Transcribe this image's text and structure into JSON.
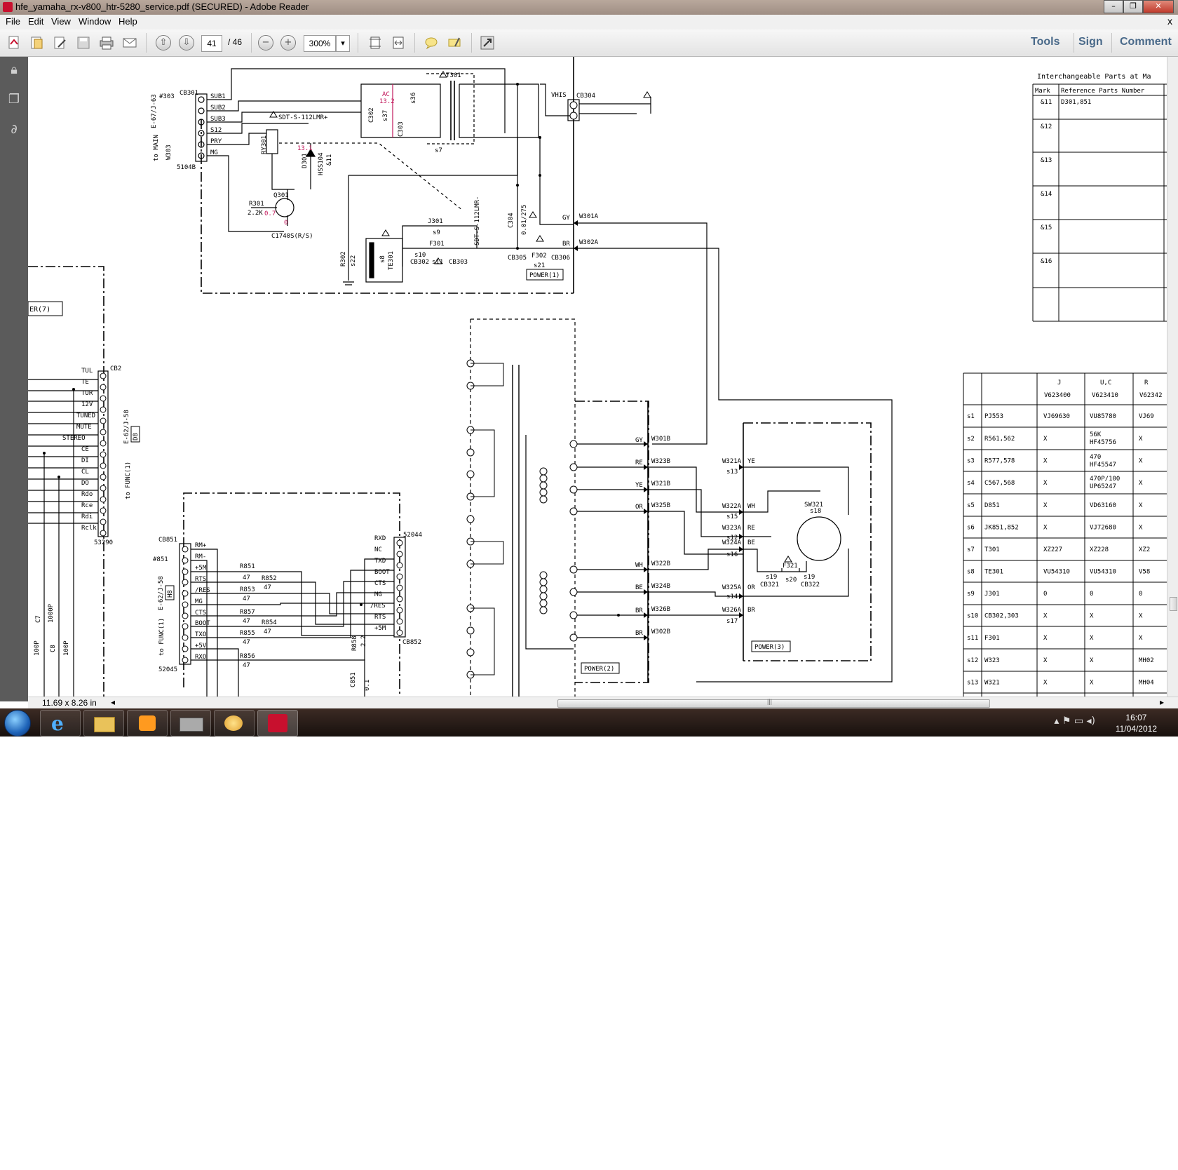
{
  "window": {
    "title": "hfe_yamaha_rx-v800_htr-5280_service.pdf (SECURED) - Adobe Reader",
    "controls": {
      "minimize": "–",
      "restore": "❐",
      "close": "✕"
    }
  },
  "menu": {
    "items": [
      "File",
      "Edit",
      "View",
      "Window",
      "Help"
    ],
    "close_doc": "x"
  },
  "toolbar": {
    "page_current": "41",
    "page_total": "/ 46",
    "zoom": "300%",
    "zoom_dropdown": "▾",
    "tools_label": "Tools",
    "sign_label": "Sign",
    "comment_label": "Comment",
    "icons": [
      "create-pdf-icon",
      "open-icon",
      "edit-icon",
      "save-icon",
      "print-icon",
      "email-icon",
      "page-up-icon",
      "page-down-icon",
      "zoom-out-icon",
      "zoom-in-icon",
      "fit-page-icon",
      "fit-width-icon",
      "comment-icon",
      "highlight-icon",
      "fullscreen-icon"
    ],
    "accent": "#4a6a8a"
  },
  "statusbar": {
    "page_size": "11.69 x 8.26 in",
    "scroll_left": "◂",
    "scroll_right": "▸",
    "thumb_grip": "|||"
  },
  "taskbar": {
    "time": "16:07",
    "date": "11/04/2012",
    "apps": [
      "internet-explorer-icon",
      "file-explorer-icon",
      "media-player-icon",
      "scanner-icon",
      "paint-icon",
      "adobe-reader-icon"
    ]
  },
  "schematic": {
    "connector_labels": [
      "SUB1",
      "SUB2",
      "SUB3",
      "S12",
      "PRY",
      "MG"
    ],
    "left_labels": [
      "#303",
      "E-67/J-63",
      "to MAIN",
      "W303",
      "CB301",
      "5104B"
    ],
    "relay": "SDT-S-112LMR+",
    "relay2": "SDT-S-112LMR-",
    "transformer": "T301",
    "parts": [
      "RY301",
      "D301",
      "HSS104",
      "&11",
      "R301",
      "2.2K",
      "Q301",
      "C1740S(R/S)",
      "C302",
      "C303",
      "s37",
      "s36",
      "s7",
      "AC",
      "13.2",
      "13.1",
      "0.7",
      "0",
      "J301",
      "s9",
      "F301",
      "s10",
      "s11",
      "CB302",
      "CB303",
      "R302",
      "s22",
      "TE301",
      "s8",
      "C304",
      "0.01/275",
      "CB305",
      "F302",
      "s21",
      "CB306",
      "VHIS",
      "CB304",
      "GY",
      "W301A",
      "BR",
      "W302A",
      "POWER(1)"
    ],
    "func_block": {
      "label": "ER(7)",
      "cb": "CB2",
      "pins": [
        "TUL",
        "TE",
        "TUR",
        "12V",
        "TUNED",
        "MUTE",
        "STEREO",
        "CE",
        "DI",
        "CL",
        "DO",
        "Rdo",
        "Rce",
        "Rdi",
        "Rclk"
      ],
      "connector": "53290",
      "side": "E-62/J-58",
      "box": "D8",
      "to": "to FUNC(1)"
    },
    "cb851": {
      "name": "CB851",
      "ref": "#851",
      "side": "E-62/J-58",
      "box": "H8",
      "to": "to FUNC(1)",
      "connector": "52045",
      "pins": [
        "RM+",
        "RM-",
        "+5M",
        "RTS",
        "/RES",
        "MG",
        "CTS",
        "BOOT",
        "TXO",
        "+5V",
        "RXO"
      ],
      "resistors": [
        "R851",
        "R852",
        "R853",
        "R857",
        "R854",
        "R855",
        "R856",
        "R858"
      ],
      "values": [
        "47",
        "47",
        "47",
        "47",
        "47",
        "47",
        "47",
        "2.2"
      ]
    },
    "cb852": {
      "name": "CB852",
      "connector": "52044",
      "pins": [
        "RXD",
        "NC",
        "TXD",
        "BOOT",
        "CTS",
        "MG",
        "/RES",
        "RTS",
        "+5M"
      ]
    },
    "caps": [
      "C7",
      "1000P",
      "C8",
      "100P",
      "100P",
      "C851",
      "0.1"
    ],
    "power2": {
      "label": "POWER(2)",
      "wires": [
        "GY",
        "RE",
        "YE",
        "OR",
        "WH",
        "BE",
        "BR",
        "BR"
      ],
      "refs": [
        "W301B",
        "W323B",
        "W321B",
        "W325B",
        "W322B",
        "W324B",
        "W326B",
        "W302B"
      ]
    },
    "power3": {
      "label": "POWER(3)",
      "refs": [
        "W321A",
        "W322A",
        "W323A",
        "W324A",
        "W325A",
        "W326A"
      ],
      "wires": [
        "YE",
        "WH",
        "RE",
        "BE",
        "OR",
        "BR"
      ],
      "s_labels": [
        "s13",
        "s15",
        "s12",
        "s16",
        "s14",
        "s17"
      ],
      "switch": "SW321",
      "switch_s": "s18",
      "fuse": "F321",
      "fuse_refs": [
        "s19",
        "s20",
        "s19",
        "CB321",
        "CB322"
      ]
    },
    "interchangeable_table": {
      "title": "Interchangeable Parts at Ma",
      "headers": [
        "Mark",
        "Reference Parts Number"
      ],
      "rows": [
        [
          "&11",
          "D301,851"
        ],
        [
          "&12",
          ""
        ],
        [
          "&13",
          ""
        ],
        [
          "&14",
          ""
        ],
        [
          "&15",
          ""
        ],
        [
          "&16",
          ""
        ],
        [
          "",
          ""
        ]
      ]
    },
    "destination_table": {
      "headers": [
        "",
        "",
        "J",
        "U,C",
        "R"
      ],
      "subheaders": [
        "",
        "",
        "V623400",
        "V623410",
        "V62342"
      ],
      "rows": [
        [
          "s1",
          "PJ553",
          "VJ69630",
          "VU85780",
          "VJ69"
        ],
        [
          "s2",
          "R561,562",
          "X",
          "56K HF45756",
          "X"
        ],
        [
          "s3",
          "R577,578",
          "X",
          "470 HF45547",
          "X"
        ],
        [
          "s4",
          "C567,568",
          "X",
          "470P/100 UP65247",
          "X"
        ],
        [
          "s5",
          "D851",
          "X",
          "VD63160",
          "X"
        ],
        [
          "s6",
          "JK851,852",
          "X",
          "VJ72680",
          "X"
        ],
        [
          "s7",
          "T301",
          "XZ227",
          "XZ228",
          "XZ2"
        ],
        [
          "s8",
          "TE301",
          "VU54310",
          "VU54310",
          "V58"
        ],
        [
          "s9",
          "J301",
          "0",
          "0",
          "0"
        ],
        [
          "s10",
          "CB302,303",
          "X",
          "X",
          "X"
        ],
        [
          "s11",
          "F301",
          "X",
          "X",
          "X"
        ],
        [
          "s12",
          "W323",
          "X",
          "X",
          "MH02"
        ],
        [
          "s13",
          "W321",
          "X",
          "X",
          "MH04"
        ]
      ]
    }
  }
}
